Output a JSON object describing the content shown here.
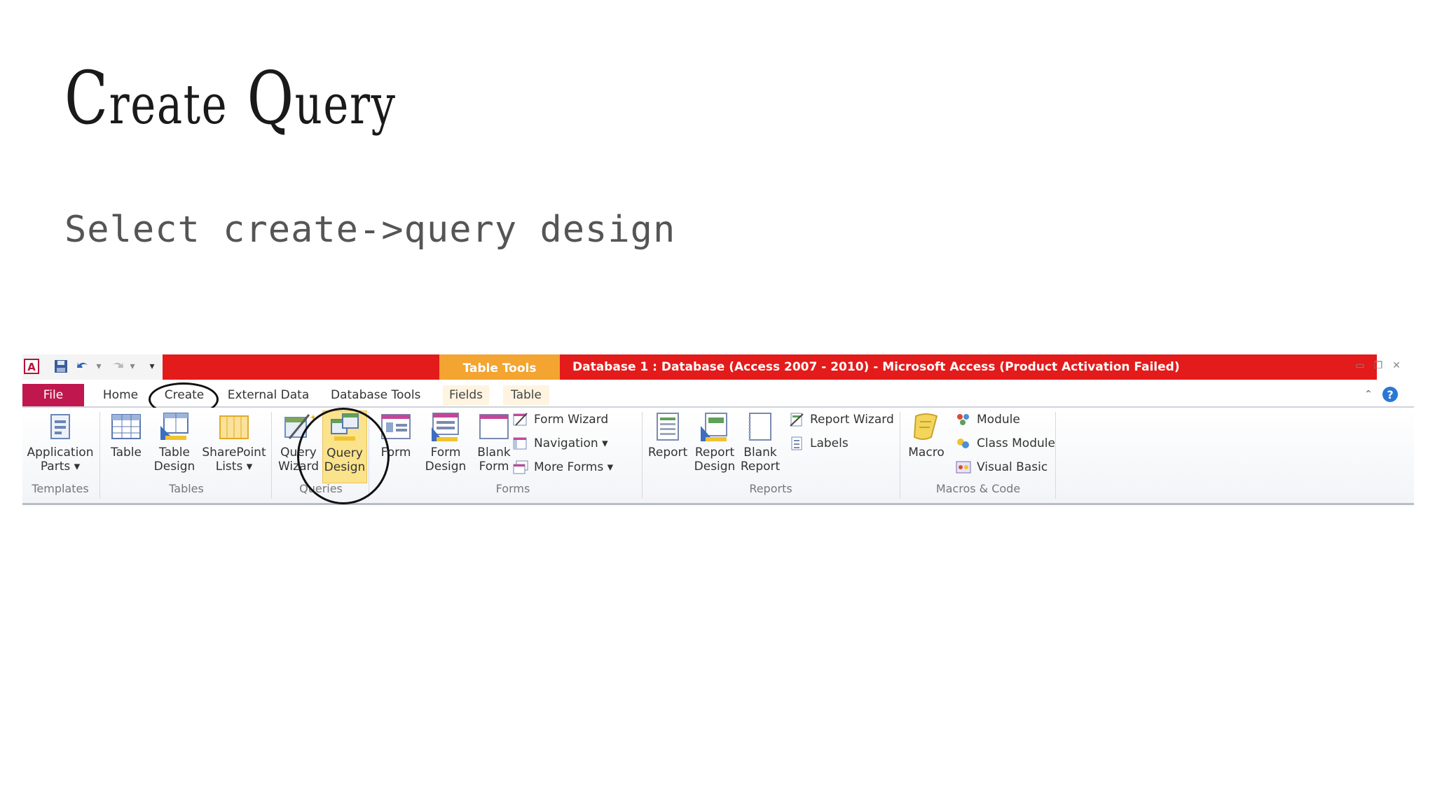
{
  "slide": {
    "title_first": "C",
    "title_first_rest": "reate",
    "title_second": "Q",
    "title_second_rest": "uery",
    "subtitle": "Select create->query design"
  },
  "window": {
    "context_tab": "Table Tools",
    "title": "Database 1 : Database (Access 2007 - 2010)  -  Microsoft Access (Product Activation Failed)"
  },
  "tabs": [
    "File",
    "Home",
    "Create",
    "External Data",
    "Database Tools",
    "Fields",
    "Table"
  ],
  "ribbon": {
    "templates": {
      "app_parts_1": "Application",
      "app_parts_2": "Parts",
      "group": "Templates"
    },
    "tables": {
      "table": "Table",
      "table_design_1": "Table",
      "table_design_2": "Design",
      "sharepoint_1": "SharePoint",
      "sharepoint_2": "Lists",
      "group": "Tables"
    },
    "queries": {
      "wizard_1": "Query",
      "wizard_2": "Wizard",
      "design_1": "Query",
      "design_2": "Design",
      "group": "Queries"
    },
    "forms": {
      "form": "Form",
      "form_design_1": "Form",
      "form_design_2": "Design",
      "blank_1": "Blank",
      "blank_2": "Form",
      "wizard": "Form Wizard",
      "navigation": "Navigation",
      "more": "More Forms",
      "group": "Forms"
    },
    "reports": {
      "report": "Report",
      "design_1": "Report",
      "design_2": "Design",
      "blank_1": "Blank",
      "blank_2": "Report",
      "wizard": "Report Wizard",
      "labels": "Labels",
      "group": "Reports"
    },
    "macros": {
      "macro": "Macro",
      "module": "Module",
      "class_module": "Class Module",
      "visual_basic": "Visual Basic",
      "group": "Macros & Code"
    }
  },
  "colors": {
    "title_bar": "#e31b1b",
    "context_tab": "#f3a431",
    "file_tab": "#c0174f",
    "selected_button": "#fbe38b"
  }
}
